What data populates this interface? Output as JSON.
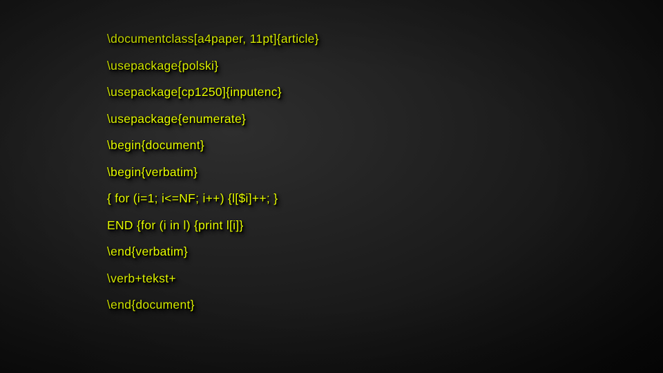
{
  "code_lines": [
    "\\documentclass[a4paper, 11pt]{article}",
    "\\usepackage{polski}",
    "\\usepackage[cp1250]{inputenc}",
    "\\usepackage{enumerate}",
    "\\begin{document}",
    "\\begin{verbatim}",
    "{ for (i=1; i<=NF; i++) {l[$i]++; }",
    "END {for (i in l) {print l[i]}",
    "\\end{verbatim}",
    "\\verb+tekst+",
    "\\end{document}"
  ]
}
